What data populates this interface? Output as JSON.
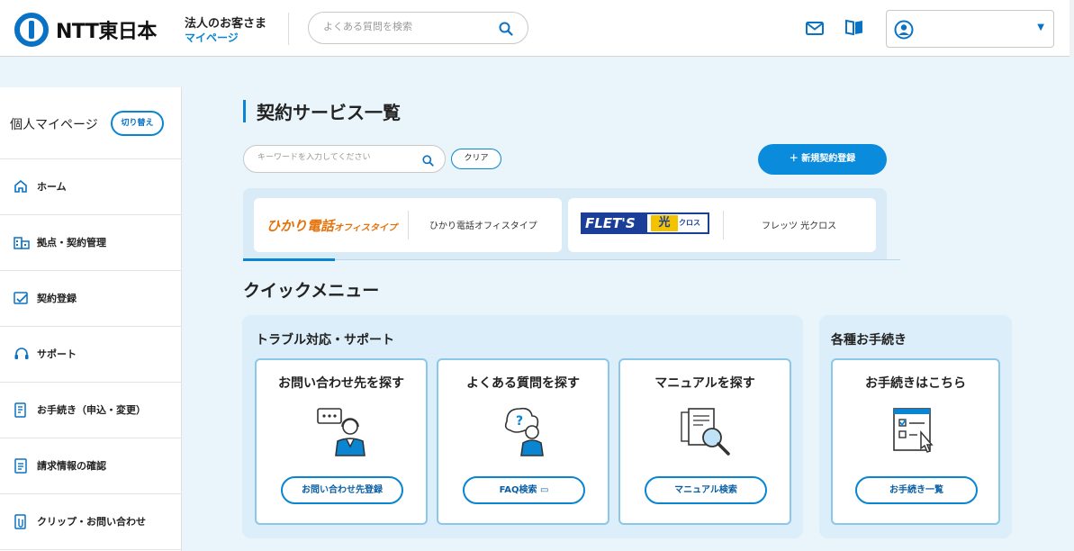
{
  "header": {
    "logo_text": "NTT東日本",
    "subtitle_top": "法人のお客さま",
    "subtitle_bottom": "マイページ",
    "search_placeholder": "よくある質問を検索",
    "account_name": ""
  },
  "sidebar": {
    "title": "個人マイページ",
    "switch_label": "切り替え",
    "items": [
      {
        "label": "ホーム",
        "icon": "home-icon"
      },
      {
        "label": "拠点・契約管理",
        "icon": "building-icon"
      },
      {
        "label": "契約登録",
        "icon": "contract-icon"
      },
      {
        "label": "サポート",
        "icon": "headset-icon"
      },
      {
        "label": "お手続き（申込・変更）",
        "icon": "form-icon"
      },
      {
        "label": "請求情報の確認",
        "icon": "invoice-icon"
      },
      {
        "label": "クリップ・お問い合わせ",
        "icon": "clip-icon"
      }
    ]
  },
  "main": {
    "page_title": "契約サービス一覧",
    "keyword_placeholder": "キーワードを入力してください",
    "clear_label": "クリア",
    "new_contract_label": "＋ 新規契約登録",
    "services": [
      {
        "logo_text": "ひかり電話",
        "logo_sub": "オフィスタイプ",
        "name": "ひかり電話オフィスタイプ"
      },
      {
        "logo_text": "FLET'S",
        "logo_sub": "光",
        "logo_sub2": "クロス",
        "name": "フレッツ 光クロス"
      }
    ],
    "quick_menu_title": "クイックメニュー",
    "trouble_panel": {
      "title": "トラブル対応・サポート",
      "cards": [
        {
          "title": "お問い合わせ先を探す",
          "button": "お問い合わせ先登録"
        },
        {
          "title": "よくある質問を探す",
          "button": "FAQ検索 ▭"
        },
        {
          "title": "マニュアルを探す",
          "button": "マニュアル検索"
        }
      ]
    },
    "procedure_panel": {
      "title": "各種お手続き",
      "cards": [
        {
          "title": "お手続きはこちら",
          "button": "お手続き一覧"
        }
      ]
    }
  },
  "colors": {
    "accent": "#0a85d1",
    "background": "#e9f4fb",
    "hikari_orange": "#e5730b",
    "flets_blue": "#1b3f98"
  }
}
